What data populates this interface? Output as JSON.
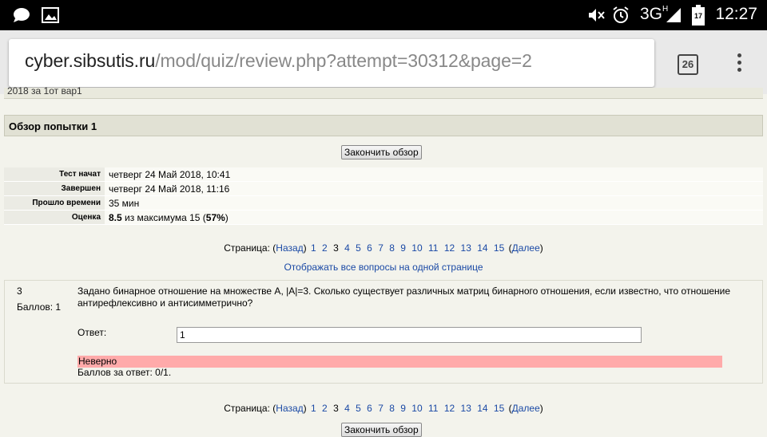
{
  "statusbar": {
    "time": "12:27",
    "network": "3G",
    "network_sup": "H",
    "battery": "17"
  },
  "browser": {
    "url_host": "cyber.sibsutis.ru",
    "url_path": "/mod/quiz/review.php?attempt=30312&page=2",
    "tab_count": "26"
  },
  "page": {
    "cutoff_text": "2018 за 1от вар1",
    "title": "Обзор попытки 1",
    "finish_button": "Закончить обзор",
    "summary": [
      {
        "label": "Тест начат",
        "value": "четверг 24 Май 2018, 10:41"
      },
      {
        "label": "Завершен",
        "value": "четверг 24 Май 2018, 11:16"
      },
      {
        "label": "Прошло времени",
        "value": "35 мин"
      }
    ],
    "grade": {
      "label": "Оценка",
      "score": "8.5",
      "middle": " из максимума 15 (",
      "percent": "57%",
      "end": ")"
    },
    "pager": {
      "prefix": "Страница: (",
      "prev": "Назад",
      "sep1": ")",
      "pages": [
        "1",
        "2",
        "3",
        "4",
        "5",
        "6",
        "7",
        "8",
        "9",
        "10",
        "11",
        "12",
        "13",
        "14",
        "15"
      ],
      "current": "3",
      "open": "(",
      "next": "Далее",
      "close": ")"
    },
    "show_all": "Отображать все вопросы на одной странице",
    "question": {
      "number": "3",
      "marks": "Баллов: 1",
      "text": "Задано бинарное отношение на множестве А, |A|=3. Сколько существует различных матриц бинарного отношения, если известно, что отношение антирефлексивно и антисимметрично?",
      "answer_label": "Ответ:",
      "answer_value": "1",
      "feedback": "Неверно",
      "grade_text": "Баллов за ответ: 0/1."
    }
  }
}
